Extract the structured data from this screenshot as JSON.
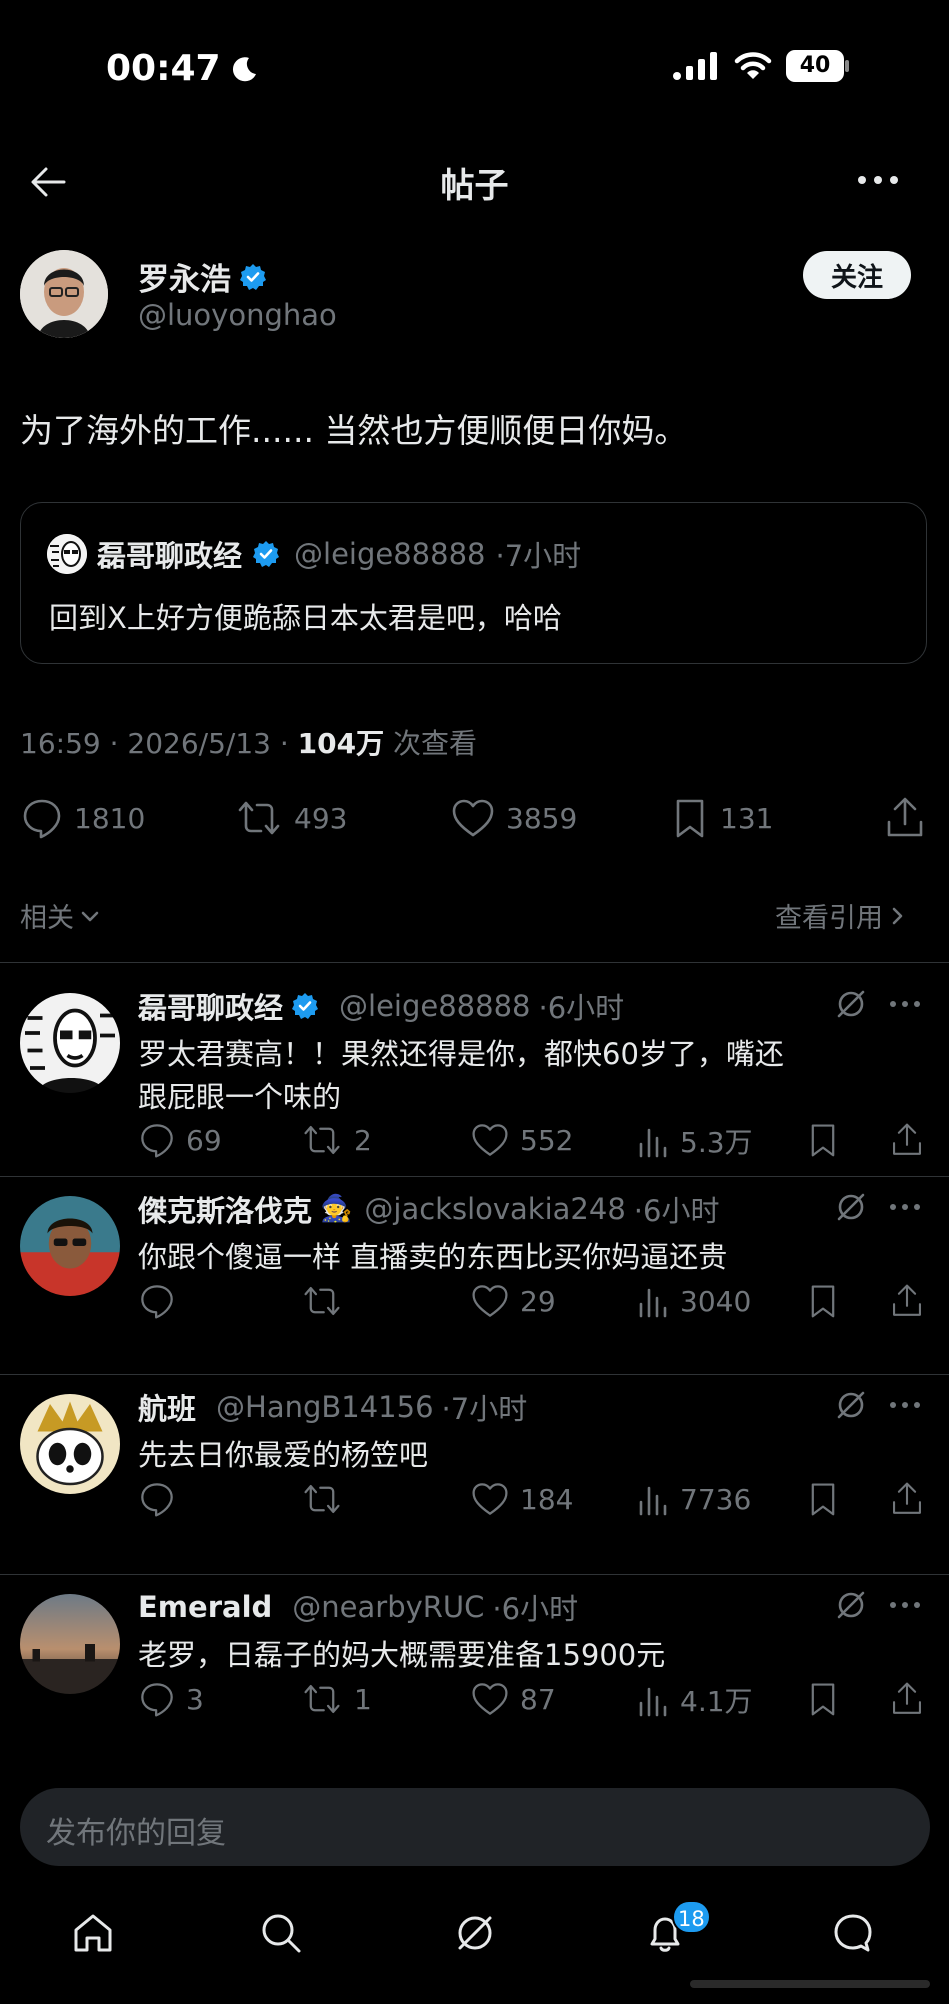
{
  "status": {
    "time": "00:47",
    "battery": "40"
  },
  "nav": {
    "title": "帖子"
  },
  "post": {
    "author": "罗永浩",
    "handle": "@luoyonghao",
    "follow_label": "关注",
    "text": "为了海外的工作...... 当然也方便顺便日你妈。",
    "quote": {
      "author": "磊哥聊政经",
      "handle": "@leige88888",
      "time": "·7小时",
      "text": "回到X上好方便跪舔日本太君是吧，哈哈"
    },
    "meta_time": "16:59 · 2026/5/13 · ",
    "views_count": "104万",
    "views_label": " 次查看",
    "stats": {
      "replies": "1810",
      "reposts": "493",
      "likes": "3859",
      "bookmarks": "131"
    }
  },
  "related": {
    "left": "相关",
    "right": "查看引用"
  },
  "replies": [
    {
      "name": "磊哥聊政经",
      "verified": true,
      "emoji": "",
      "handle": "@leige88888",
      "time": "·6小时",
      "line1": "罗太君赛高！！果然还得是你，都快60岁了，嘴还",
      "line2": "跟屁眼一个味的",
      "replies": "69",
      "reposts": "2",
      "likes": "552",
      "views": "5.3万"
    },
    {
      "name": "傑克斯洛伐克",
      "verified": false,
      "emoji": "🧙",
      "handle": "@jackslovakia248",
      "time": "·6小时",
      "line1": "你跟个傻逼一样 直播卖的东西比买你妈逼还贵",
      "line2": "",
      "replies": "",
      "reposts": "",
      "likes": "29",
      "views": "3040"
    },
    {
      "name": "航班",
      "verified": false,
      "emoji": "",
      "handle": "@HangB14156",
      "time": "·7小时",
      "line1": "先去日你最爱的杨笠吧",
      "line2": "",
      "replies": "",
      "reposts": "",
      "likes": "184",
      "views": "7736"
    },
    {
      "name": "Emerald",
      "verified": false,
      "emoji": "",
      "handle": "@nearbyRUC",
      "time": "·6小时",
      "line1": "老罗，日磊子的妈大概需要准备15900元",
      "line2": "",
      "replies": "3",
      "reposts": "1",
      "likes": "87",
      "views": "4.1万"
    }
  ],
  "composer": {
    "placeholder": "发布你的回复"
  },
  "tabbar": {
    "notifications_badge": "18"
  },
  "colors": {
    "accent": "#1d9bf0",
    "background": "#000000",
    "muted": "#71767b"
  }
}
